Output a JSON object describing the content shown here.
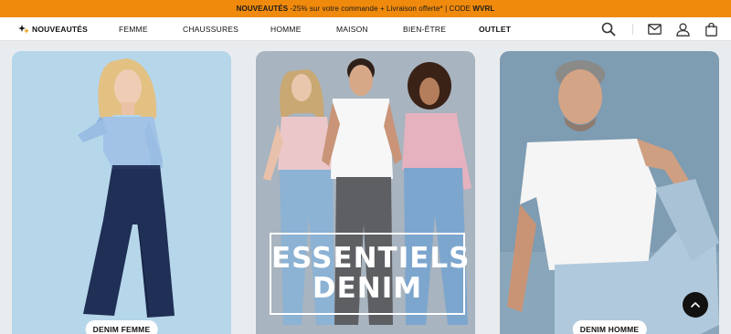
{
  "promo": {
    "highlight": "NOUVEAUTÉS",
    "text": " -25% sur votre commande + Livraison offerte* | CODE ",
    "code": "WVRL"
  },
  "nav": {
    "items": [
      {
        "label": "NOUVEAUTÉS"
      },
      {
        "label": "FEMME"
      },
      {
        "label": "CHAUSSURES"
      },
      {
        "label": "HOMME"
      },
      {
        "label": "MAISON"
      },
      {
        "label": "BIEN-ÊTRE"
      },
      {
        "label": "OUTLET"
      }
    ],
    "icons": [
      "search-icon",
      "mail-icon",
      "user-icon",
      "bag-icon"
    ]
  },
  "cards": [
    {
      "label": "DENIM FEMME"
    },
    {
      "hero_line1": "ESSENTIELS",
      "hero_line2": "DENIM"
    },
    {
      "label": "DENIM HOMME"
    }
  ],
  "colors": {
    "promo_bg": "#f08a0c",
    "page_bg": "#e9ecef"
  }
}
